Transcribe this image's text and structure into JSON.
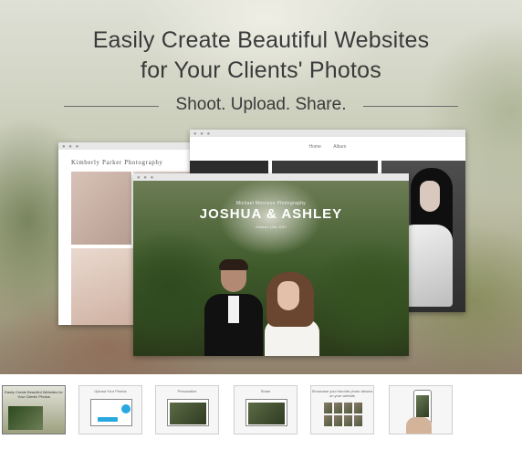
{
  "hero": {
    "headline_line1": "Easily Create Beautiful Websites",
    "headline_line2": "for Your Clients' Photos",
    "tagline": "Shoot. Upload. Share."
  },
  "windows": {
    "left_site_title": "Kimberly Parker Photography",
    "back_nav": [
      "Home",
      "Album"
    ],
    "front_small": "Michael Morrison Photography",
    "front_names": "JOSHUA & ASHLEY",
    "front_date": "October 14th, 2017"
  },
  "thumbnails": [
    {
      "caption": "Easily Create Beautiful Websites for Your Clients' Photos",
      "caption2": "Shoot. Upload. Share.",
      "active": true
    },
    {
      "caption": "Upload Your Photos"
    },
    {
      "caption": "Personalize"
    },
    {
      "caption": "Share"
    },
    {
      "caption": "Showcase your favorite photo albums on your website"
    },
    {
      "caption": ""
    }
  ],
  "colors": {
    "accent": "#29a8e0",
    "headline_text": "#3a3a3a"
  }
}
